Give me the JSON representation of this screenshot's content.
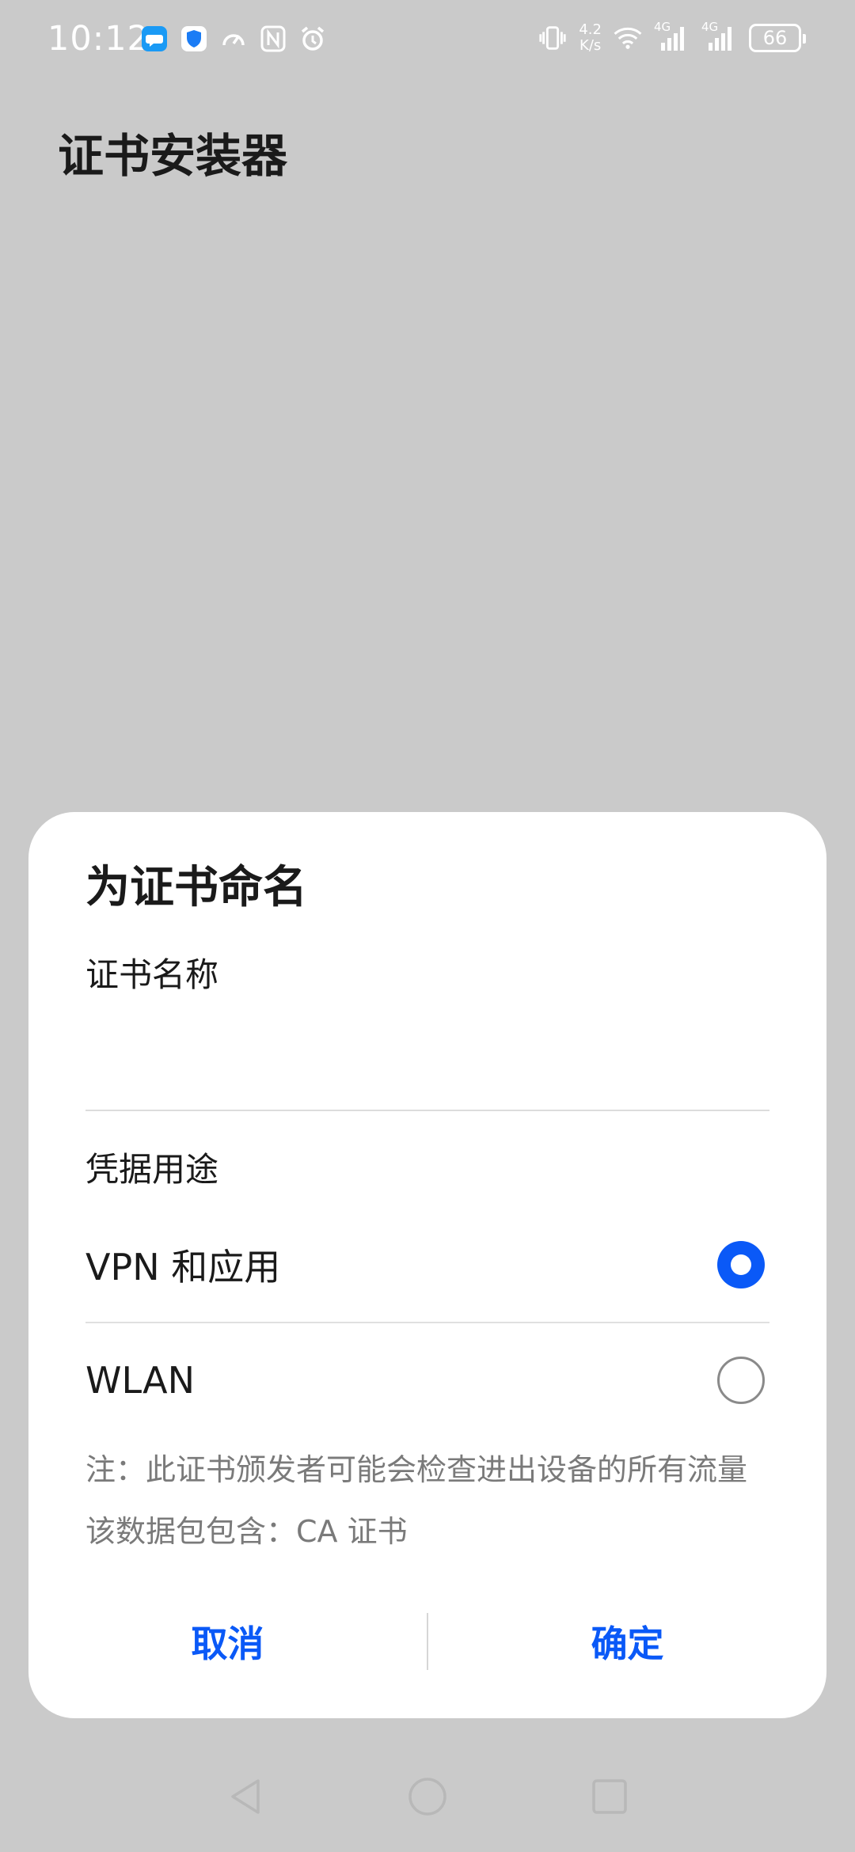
{
  "status_bar": {
    "time": "10:12",
    "net_speed_value": "4.2",
    "net_speed_unit": "K/s",
    "signal1_label": "4G",
    "signal2_label": "4G",
    "battery": "66",
    "icons": [
      "message-icon",
      "shield-icon",
      "speedometer-icon",
      "nfc-icon",
      "alarm-icon",
      "vibrate-icon",
      "wifi-icon",
      "signal-icon",
      "signal-icon",
      "battery-icon"
    ]
  },
  "app": {
    "title": "证书安装器"
  },
  "dialog": {
    "title": "为证书命名",
    "name_label": "证书名称",
    "name_value": "",
    "usage_label": "凭据用途",
    "options": [
      {
        "label": "VPN 和应用",
        "selected": true
      },
      {
        "label": "WLAN",
        "selected": false
      }
    ],
    "note_line1": "注：此证书颁发者可能会检查进出设备的所有流量",
    "note_line2": "该数据包包含：CA 证书",
    "cancel_label": "取消",
    "confirm_label": "确定"
  },
  "colors": {
    "accent": "#0a59f7",
    "scrim": "#cacaca",
    "dialog_bg": "#ffffff"
  },
  "nav": [
    "back-icon",
    "home-icon",
    "recents-icon"
  ]
}
